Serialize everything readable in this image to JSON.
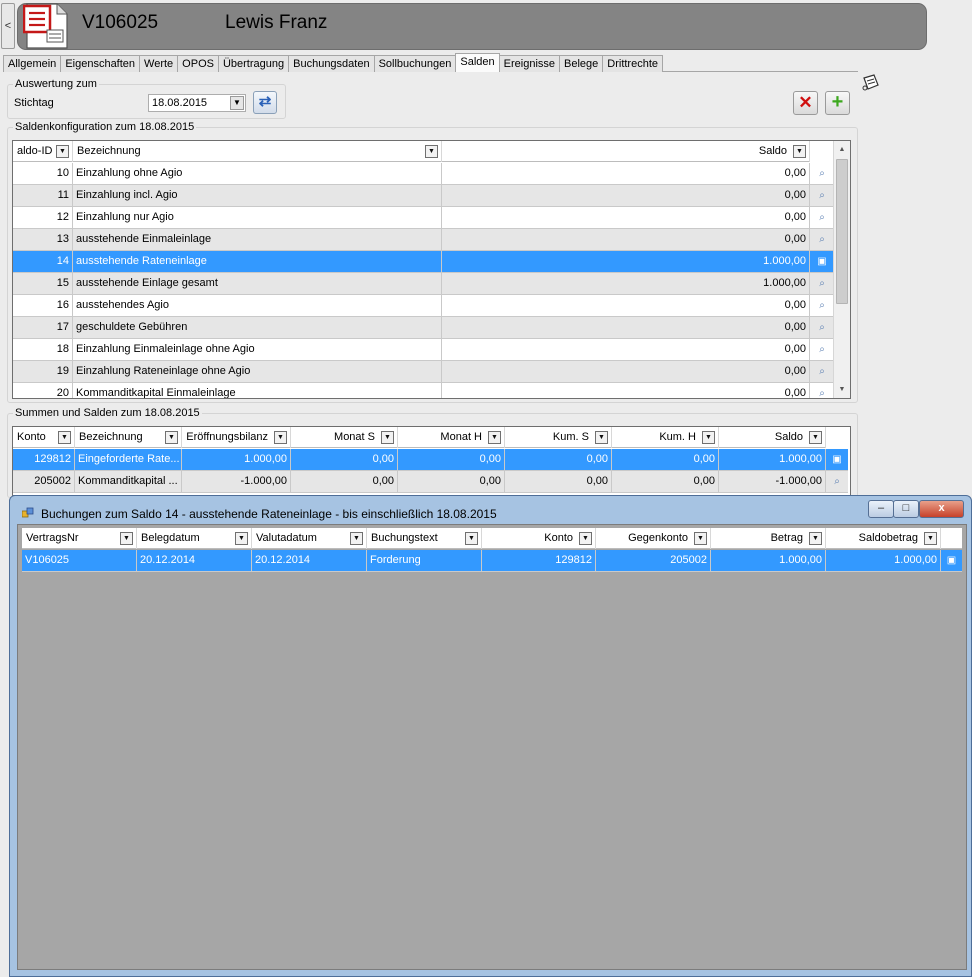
{
  "header": {
    "collapse_label": "<",
    "contract_no": "V106025",
    "customer_name": "Lewis Franz"
  },
  "tabs": [
    "Allgemein",
    "Eigenschaften",
    "Werte",
    "OPOS",
    "Übertragung",
    "Buchungsdaten",
    "Sollbuchungen",
    "Salden",
    "Ereignisse",
    "Belege",
    "Drittrechte"
  ],
  "active_tab": "Salden",
  "auswertung": {
    "group_title": "Auswertung zum",
    "stichtag_label": "Stichtag",
    "stichtag_value": "18.08.2015"
  },
  "saldenkonfiguration": {
    "group_title": "Saldenkonfiguration zum 18.08.2015",
    "columns": [
      "aldo-ID",
      "Bezeichnung",
      "",
      "Saldo"
    ],
    "rows": [
      {
        "id": "10",
        "bez": "Einzahlung ohne Agio",
        "saldo": "0,00"
      },
      {
        "id": "11",
        "bez": "Einzahlung incl. Agio",
        "saldo": "0,00"
      },
      {
        "id": "12",
        "bez": "Einzahlung nur Agio",
        "saldo": "0,00"
      },
      {
        "id": "13",
        "bez": "ausstehende Einmaleinlage",
        "saldo": "0,00"
      },
      {
        "id": "14",
        "bez": "ausstehende Rateneinlage",
        "saldo": "1.000,00"
      },
      {
        "id": "15",
        "bez": "ausstehende Einlage gesamt",
        "saldo": "1.000,00"
      },
      {
        "id": "16",
        "bez": "ausstehendes Agio",
        "saldo": "0,00"
      },
      {
        "id": "17",
        "bez": "geschuldete Gebühren",
        "saldo": "0,00"
      },
      {
        "id": "18",
        "bez": "Einzahlung Einmaleinlage ohne Agio",
        "saldo": "0,00"
      },
      {
        "id": "19",
        "bez": "Einzahlung Rateneinlage ohne Agio",
        "saldo": "0,00"
      },
      {
        "id": "20",
        "bez": "Kommanditkapital Einmaleinlage",
        "saldo": "0,00"
      }
    ]
  },
  "summen": {
    "group_title": "Summen und Salden zum 18.08.2015",
    "columns": [
      "Konto",
      "Bezeichnung",
      "Eröffnungsbilanz",
      "Monat S",
      "Monat H",
      "Kum. S",
      "Kum. H",
      "Saldo"
    ],
    "rows": [
      {
        "konto": "129812",
        "bez": "Eingeforderte Rate...",
        "eb": "1.000,00",
        "ms": "0,00",
        "mh": "0,00",
        "ks": "0,00",
        "kh": "0,00",
        "saldo": "1.000,00"
      },
      {
        "konto": "205002",
        "bez": "Kommanditkapital ...",
        "eb": "-1.000,00",
        "ms": "0,00",
        "mh": "0,00",
        "ks": "0,00",
        "kh": "0,00",
        "saldo": "-1.000,00"
      }
    ]
  },
  "dialog": {
    "title": "Buchungen zum Saldo 14 - ausstehende Rateneinlage - bis einschließlich 18.08.2015",
    "minimize": "–",
    "maximize": "□",
    "close": "x",
    "columns": [
      "VertragsNr",
      "Belegdatum",
      "Valutadatum",
      "Buchungstext",
      "Konto",
      "Gegenkonto",
      "Betrag",
      "Saldobetrag"
    ],
    "rows": [
      {
        "vnr": "V106025",
        "beleg": "20.12.2014",
        "valuta": "20.12.2014",
        "text": "Forderung",
        "konto": "129812",
        "gegen": "205002",
        "betrag": "1.000,00",
        "saldo": "1.000,00"
      }
    ]
  },
  "icons": {
    "refresh": "refresh-icon",
    "delete": "delete-icon",
    "add": "add-icon",
    "row_action": "magnifier-icon"
  },
  "colors": {
    "selection": "#3399ff",
    "header_bar": "#848484",
    "dialog_frame": "#a6c3e2"
  }
}
